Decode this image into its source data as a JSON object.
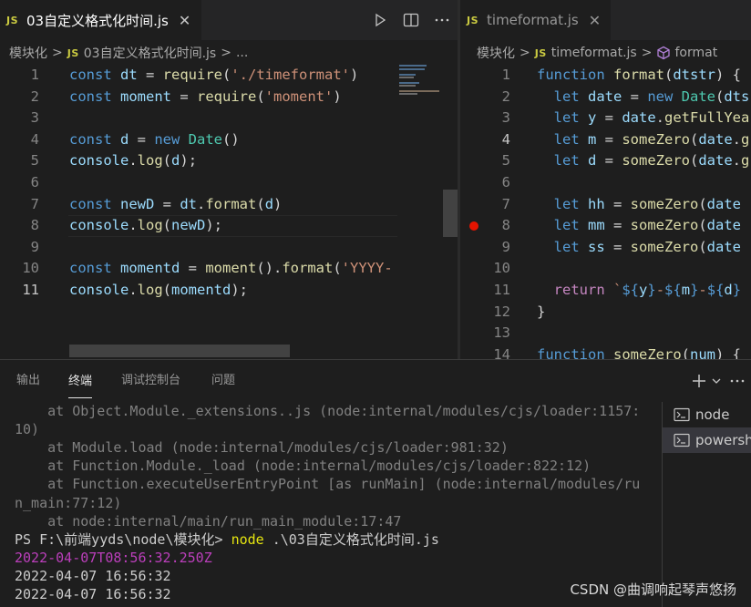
{
  "left_editor": {
    "tab": {
      "badge": "JS",
      "label": "03自定义格式化时间.js",
      "close": "✕"
    },
    "breadcrumb": {
      "folder": "模块化",
      "sep1": ">",
      "badge": "JS",
      "file": "03自定义格式化时间.js",
      "sep2": ">",
      "more": "..."
    },
    "actions": {
      "run": "run-icon",
      "split": "split-editor-icon",
      "more": "..."
    },
    "active_line": 11,
    "lines": [
      {
        "n": "1",
        "tokens": [
          [
            "kw",
            "const "
          ],
          [
            "var",
            "dt"
          ],
          [
            "op",
            " = "
          ],
          [
            "fn",
            "require"
          ],
          [
            "op",
            "("
          ],
          [
            "str",
            "'./timeformat'"
          ],
          [
            "op",
            ")"
          ]
        ]
      },
      {
        "n": "2",
        "tokens": [
          [
            "kw",
            "const "
          ],
          [
            "var",
            "moment"
          ],
          [
            "op",
            " = "
          ],
          [
            "fn",
            "require"
          ],
          [
            "op",
            "("
          ],
          [
            "str",
            "'moment'"
          ],
          [
            "op",
            ")"
          ]
        ]
      },
      {
        "n": "3",
        "tokens": []
      },
      {
        "n": "4",
        "tokens": [
          [
            "kw",
            "const "
          ],
          [
            "var",
            "d"
          ],
          [
            "op",
            " = "
          ],
          [
            "kw",
            "new "
          ],
          [
            "cls",
            "Date"
          ],
          [
            "op",
            "()"
          ]
        ]
      },
      {
        "n": "5",
        "tokens": [
          [
            "var",
            "console"
          ],
          [
            "op",
            "."
          ],
          [
            "fn",
            "log"
          ],
          [
            "op",
            "("
          ],
          [
            "var",
            "d"
          ],
          [
            "op",
            ");"
          ]
        ]
      },
      {
        "n": "6",
        "tokens": []
      },
      {
        "n": "7",
        "tokens": [
          [
            "kw",
            "const "
          ],
          [
            "var",
            "newD"
          ],
          [
            "op",
            " = "
          ],
          [
            "var",
            "dt"
          ],
          [
            "op",
            "."
          ],
          [
            "fn",
            "format"
          ],
          [
            "op",
            "("
          ],
          [
            "var",
            "d"
          ],
          [
            "op",
            ")"
          ]
        ]
      },
      {
        "n": "8",
        "tokens": [
          [
            "var",
            "console"
          ],
          [
            "op",
            "."
          ],
          [
            "fn",
            "log"
          ],
          [
            "op",
            "("
          ],
          [
            "var",
            "newD"
          ],
          [
            "op",
            ");"
          ]
        ]
      },
      {
        "n": "9",
        "tokens": []
      },
      {
        "n": "10",
        "tokens": [
          [
            "kw",
            "const "
          ],
          [
            "var",
            "momentd"
          ],
          [
            "op",
            " = "
          ],
          [
            "fn",
            "moment"
          ],
          [
            "op",
            "()."
          ],
          [
            "fn",
            "format"
          ],
          [
            "op",
            "("
          ],
          [
            "str",
            "'YYYY-"
          ]
        ]
      },
      {
        "n": "11",
        "tokens": [
          [
            "var",
            "console"
          ],
          [
            "op",
            "."
          ],
          [
            "fn",
            "log"
          ],
          [
            "op",
            "("
          ],
          [
            "var",
            "momentd"
          ],
          [
            "op",
            ");"
          ]
        ]
      }
    ]
  },
  "right_editor": {
    "tab": {
      "badge": "JS",
      "label": "timeformat.js",
      "close": "✕"
    },
    "breadcrumb": {
      "folder": "模块化",
      "sep1": ">",
      "badge": "JS",
      "file": "timeformat.js",
      "sep2": ">",
      "symbol": "format"
    },
    "active_line": 4,
    "breakpoint_line": 8,
    "lines": [
      {
        "n": "1",
        "tokens": [
          [
            "kw",
            "function "
          ],
          [
            "fn",
            "format"
          ],
          [
            "op",
            "("
          ],
          [
            "var",
            "dtstr"
          ],
          [
            "op",
            ") {"
          ]
        ]
      },
      {
        "n": "2",
        "tokens": [
          [
            "op",
            "  "
          ],
          [
            "kw",
            "let "
          ],
          [
            "var",
            "date"
          ],
          [
            "op",
            " = "
          ],
          [
            "kw",
            "new "
          ],
          [
            "cls",
            "Date"
          ],
          [
            "op",
            "("
          ],
          [
            "var",
            "dts"
          ]
        ]
      },
      {
        "n": "3",
        "tokens": [
          [
            "op",
            "  "
          ],
          [
            "kw",
            "let "
          ],
          [
            "var",
            "y"
          ],
          [
            "op",
            " = "
          ],
          [
            "var",
            "date"
          ],
          [
            "op",
            "."
          ],
          [
            "fn",
            "getFullYea"
          ]
        ]
      },
      {
        "n": "4",
        "tokens": [
          [
            "op",
            "  "
          ],
          [
            "kw",
            "let "
          ],
          [
            "var",
            "m"
          ],
          [
            "op",
            " = "
          ],
          [
            "fn",
            "someZero"
          ],
          [
            "op",
            "("
          ],
          [
            "var",
            "date"
          ],
          [
            "op",
            "."
          ],
          [
            "fn",
            "g"
          ]
        ]
      },
      {
        "n": "5",
        "tokens": [
          [
            "op",
            "  "
          ],
          [
            "kw",
            "let "
          ],
          [
            "var",
            "d"
          ],
          [
            "op",
            " = "
          ],
          [
            "fn",
            "someZero"
          ],
          [
            "op",
            "("
          ],
          [
            "var",
            "date"
          ],
          [
            "op",
            "."
          ],
          [
            "fn",
            "g"
          ]
        ]
      },
      {
        "n": "6",
        "tokens": []
      },
      {
        "n": "7",
        "tokens": [
          [
            "op",
            "  "
          ],
          [
            "kw",
            "let "
          ],
          [
            "var",
            "hh"
          ],
          [
            "op",
            " = "
          ],
          [
            "fn",
            "someZero"
          ],
          [
            "op",
            "("
          ],
          [
            "var",
            "date"
          ]
        ]
      },
      {
        "n": "8",
        "tokens": [
          [
            "op",
            "  "
          ],
          [
            "kw",
            "let "
          ],
          [
            "var",
            "mm"
          ],
          [
            "op",
            " = "
          ],
          [
            "fn",
            "someZero"
          ],
          [
            "op",
            "("
          ],
          [
            "var",
            "date"
          ]
        ]
      },
      {
        "n": "9",
        "tokens": [
          [
            "op",
            "  "
          ],
          [
            "kw",
            "let "
          ],
          [
            "var",
            "ss"
          ],
          [
            "op",
            " = "
          ],
          [
            "fn",
            "someZero"
          ],
          [
            "op",
            "("
          ],
          [
            "var",
            "date"
          ]
        ]
      },
      {
        "n": "10",
        "tokens": []
      },
      {
        "n": "11",
        "tokens": [
          [
            "op",
            "  "
          ],
          [
            "ctl",
            "return "
          ],
          [
            "str",
            "`"
          ],
          [
            "tpl",
            "${"
          ],
          [
            "var",
            "y"
          ],
          [
            "tpl",
            "}"
          ],
          [
            "str",
            "-"
          ],
          [
            "tpl",
            "${"
          ],
          [
            "var",
            "m"
          ],
          [
            "tpl",
            "}"
          ],
          [
            "str",
            "-"
          ],
          [
            "tpl",
            "${"
          ],
          [
            "var",
            "d"
          ],
          [
            "tpl",
            "}"
          ]
        ]
      },
      {
        "n": "12",
        "tokens": [
          [
            "op",
            "}"
          ]
        ]
      },
      {
        "n": "13",
        "tokens": []
      },
      {
        "n": "14",
        "tokens": [
          [
            "kw",
            "function "
          ],
          [
            "fn",
            "someZero"
          ],
          [
            "op",
            "("
          ],
          [
            "var",
            "num"
          ],
          [
            "op",
            ") {"
          ]
        ]
      }
    ]
  },
  "panel": {
    "tabs": [
      {
        "label": "输出",
        "active": false
      },
      {
        "label": "终端",
        "active": true
      },
      {
        "label": "调试控制台",
        "active": false
      },
      {
        "label": "问题",
        "active": false
      }
    ],
    "actions": {
      "add": "+",
      "dropdown": "chevron-down-icon",
      "more": "..."
    },
    "terminal_lines": [
      {
        "text": "    at Object.Module._extensions..js (node:internal/modules/cjs/loader:1157:",
        "style": "dim"
      },
      {
        "text": "10)",
        "style": "dim"
      },
      {
        "text": "    at Module.load (node:internal/modules/cjs/loader:981:32)",
        "style": "dim"
      },
      {
        "text": "    at Function.Module._load (node:internal/modules/cjs/loader:822:12)",
        "style": "dim"
      },
      {
        "text": "    at Function.executeUserEntryPoint [as runMain] (node:internal/modules/ru",
        "style": "dim"
      },
      {
        "text": "n_main:77:12)",
        "style": "dim"
      },
      {
        "text": "    at node:internal/main/run_main_module:17:47",
        "style": "dim"
      },
      {
        "text": "PS F:\\前端yyds\\node\\模块化> ",
        "cmd": "node",
        "rest": " .\\03自定义格式化时间.js",
        "style": "prompt"
      },
      {
        "text": "2022-04-07T08:56:32.250Z",
        "style": "magenta"
      },
      {
        "text": "2022-04-07 16:56:32",
        "style": "normal"
      },
      {
        "text": "2022-04-07 16:56:32",
        "style": "normal"
      }
    ],
    "terminal_list": [
      {
        "label": "node",
        "selected": false
      },
      {
        "label": "powersh",
        "selected": true
      }
    ]
  },
  "watermark": "CSDN @曲调响起琴声悠扬"
}
